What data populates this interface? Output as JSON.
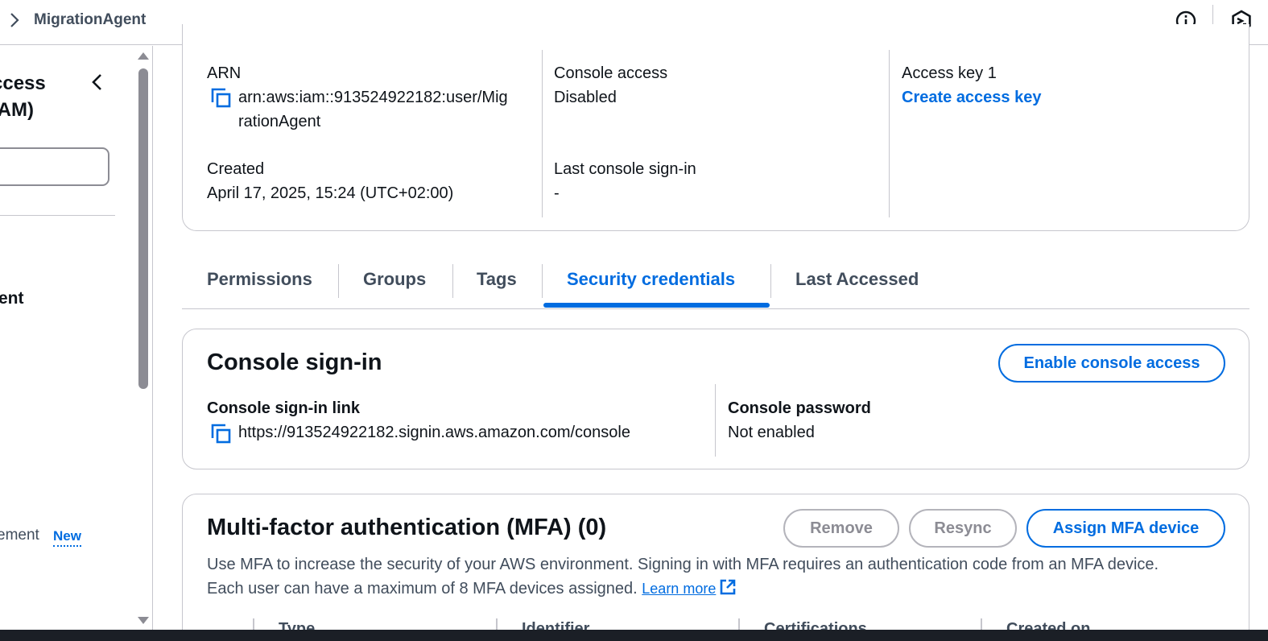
{
  "breadcrumb": {
    "current": "MigrationAgent"
  },
  "sidenav": {
    "title_line1": "ccess",
    "title_line2": "IAM)",
    "item_user": "ent",
    "item_management": "ement",
    "badge_new": "New"
  },
  "summary": {
    "arn_label": "ARN",
    "arn_value": "arn:aws:iam::913524922182:user/MigrationAgent",
    "arn_line1": "arn:aws:iam::913524922182:user/Mig",
    "arn_line2": "rationAgent",
    "created_label": "Created",
    "created_value": "April 17, 2025, 15:24 (UTC+02:00)",
    "console_access_label": "Console access",
    "console_access_value": "Disabled",
    "last_signin_label": "Last console sign-in",
    "last_signin_value": "-",
    "access_key_label": "Access key 1",
    "access_key_link": "Create access key"
  },
  "tabs": [
    {
      "label": "Permissions",
      "active": false
    },
    {
      "label": "Groups",
      "active": false
    },
    {
      "label": "Tags",
      "active": false
    },
    {
      "label": "Security credentials",
      "active": true
    },
    {
      "label": "Last Accessed",
      "active": false
    }
  ],
  "console_signin": {
    "title": "Console sign-in",
    "enable_button": "Enable console access",
    "link_label": "Console sign-in link",
    "link_value": "https://913524922182.signin.aws.amazon.com/console",
    "password_label": "Console password",
    "password_value": "Not enabled"
  },
  "mfa": {
    "title": "Multi-factor authentication (MFA) (0)",
    "remove_button": "Remove",
    "resync_button": "Resync",
    "assign_button": "Assign MFA device",
    "description_line1": "Use MFA to increase the security of your AWS environment. Signing in with MFA requires an authentication code from an MFA device.",
    "description_line2": "Each user can have a maximum of 8 MFA devices assigned.",
    "learn_more": "Learn more",
    "columns": [
      "Type",
      "Identifier",
      "Certifications",
      "Created on"
    ]
  },
  "colors": {
    "accent": "#006ce0",
    "text": "#0f141a",
    "muted": "#414d5c",
    "border": "#c6c6cd"
  }
}
